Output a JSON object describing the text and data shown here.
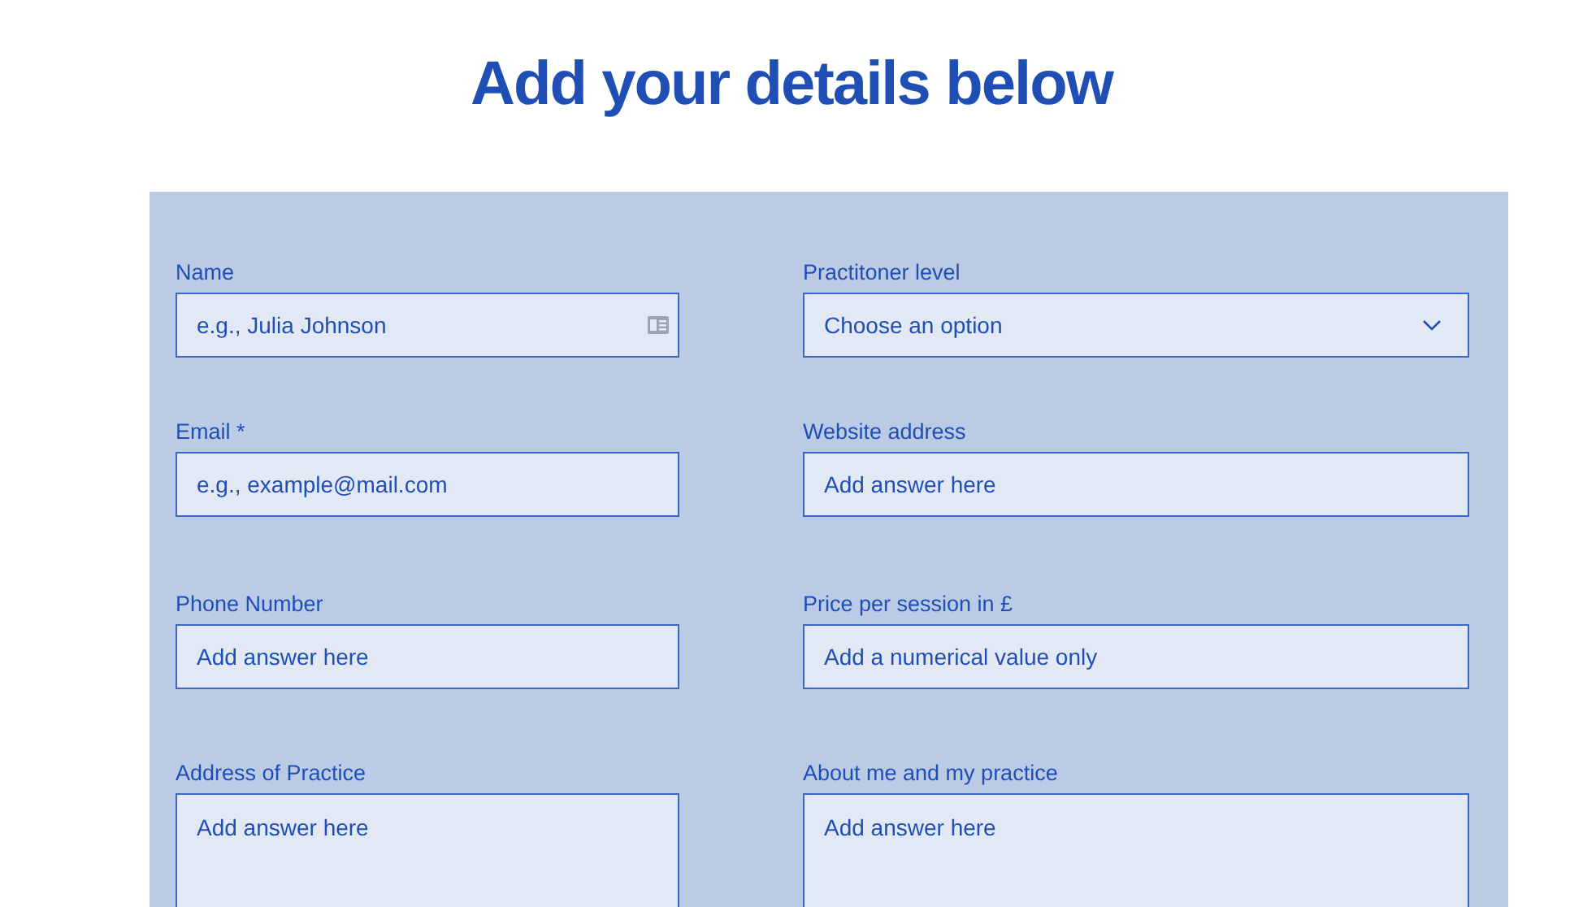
{
  "title": "Add your details below",
  "form": {
    "rows": [
      [
        {
          "label": "Name",
          "kind": "text",
          "placeholder": "e.g., Julia Johnson",
          "contact_icon": true
        },
        {
          "label": "Practitoner level",
          "kind": "select",
          "placeholder": "Choose an option"
        }
      ],
      [
        {
          "label": "Email *",
          "kind": "text",
          "placeholder": "e.g., example@mail.com"
        },
        {
          "label": "Website address",
          "kind": "text",
          "placeholder": "Add answer here"
        }
      ],
      [
        {
          "label": "Phone Number",
          "kind": "text",
          "placeholder": "Add answer here"
        },
        {
          "label": "Price per session in £",
          "kind": "text",
          "placeholder": "Add a numerical value only"
        }
      ],
      [
        {
          "label": "Address of Practice",
          "kind": "textarea",
          "placeholder": "Add answer here"
        },
        {
          "label": "About me and my practice",
          "kind": "textarea",
          "placeholder": "Add answer here"
        }
      ]
    ]
  }
}
